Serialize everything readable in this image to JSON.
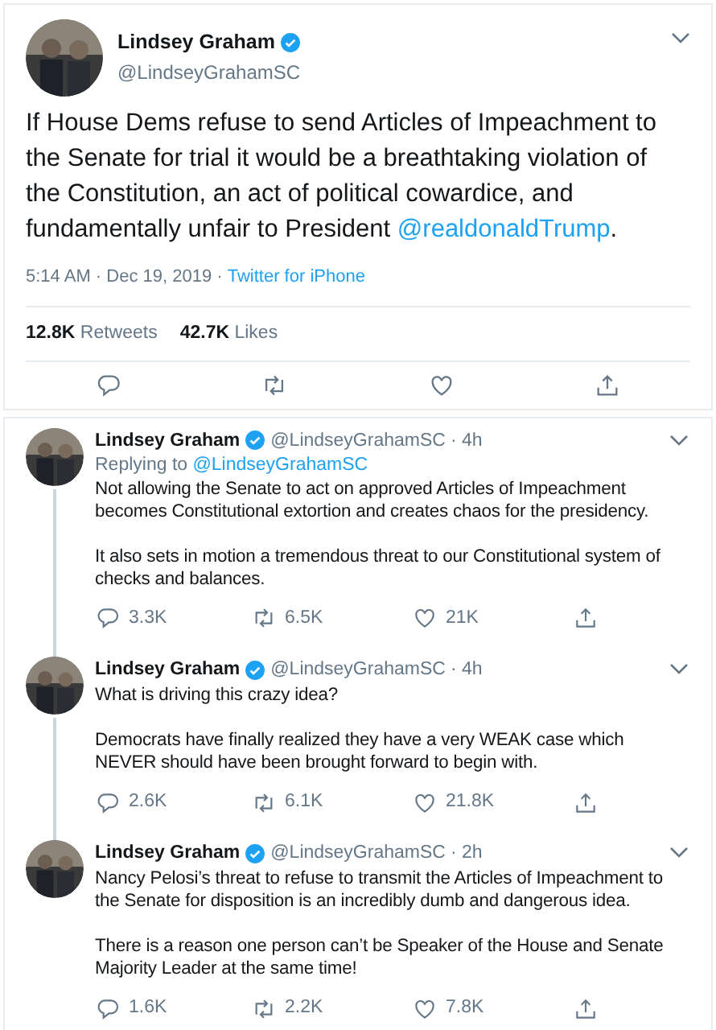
{
  "main_tweet": {
    "name": "Lindsey Graham",
    "verified": true,
    "handle": "@LindseyGrahamSC",
    "text_parts": [
      {
        "kind": "plain",
        "text": "If House Dems refuse to send Articles of Impeachment to the Senate for trial it would be a breathtaking violation of the Constitution, an act of political cowardice, and fundamentally unfair to President "
      },
      {
        "kind": "mention",
        "text": "@realdonaldTrump"
      },
      {
        "kind": "plain",
        "text": "."
      }
    ],
    "time": "5:14 AM · Dec 19, 2019 · ",
    "source": "Twitter for iPhone",
    "stats": [
      {
        "count": "12.8K",
        "label": "Retweets"
      },
      {
        "count": "42.7K",
        "label": "Likes"
      }
    ]
  },
  "replies": [
    {
      "name": "Lindsey Graham",
      "verified": true,
      "handle": "@LindseyGrahamSC",
      "age": "· 4h",
      "replying_to": {
        "label": "Replying to ",
        "handle": "@LindseyGrahamSC"
      },
      "threaded": true,
      "paragraphs": [
        "Not allowing the Senate to act on approved Articles of Impeachment becomes Constitutional extortion and creates chaos for the presidency.",
        "It also sets in motion a tremendous threat to our Constitutional system of checks and balances."
      ],
      "replies_count": "3.3K",
      "retweets": "6.5K",
      "likes": "21K"
    },
    {
      "name": "Lindsey Graham",
      "verified": true,
      "handle": "@LindseyGrahamSC",
      "age": "· 4h",
      "threaded": true,
      "paragraphs": [
        "What is driving this crazy idea?",
        "Democrats have finally realized they have a very WEAK case which NEVER should have been brought forward to begin with."
      ],
      "replies_count": "2.6K",
      "retweets": "6.1K",
      "likes": "21.8K"
    },
    {
      "name": "Lindsey Graham",
      "verified": true,
      "handle": "@LindseyGrahamSC",
      "age": "· 2h",
      "threaded": false,
      "paragraphs": [
        "Nancy Pelosi’s threat to refuse to transmit the Articles of Impeachment to the Senate for disposition is an incredibly dumb and dangerous idea.",
        "There is a reason one person can’t be Speaker of the House and Senate Majority Leader at the same time!"
      ],
      "replies_count": "1.6K",
      "retweets": "2.2K",
      "likes": "7.8K"
    }
  ]
}
